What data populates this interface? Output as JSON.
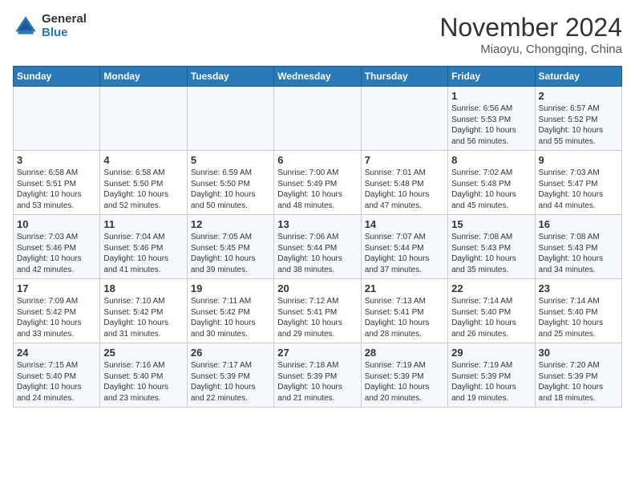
{
  "logo": {
    "general": "General",
    "blue": "Blue"
  },
  "title": "November 2024",
  "subtitle": "Miaoyu, Chongqing, China",
  "headers": [
    "Sunday",
    "Monday",
    "Tuesday",
    "Wednesday",
    "Thursday",
    "Friday",
    "Saturday"
  ],
  "weeks": [
    [
      {
        "day": "",
        "content": ""
      },
      {
        "day": "",
        "content": ""
      },
      {
        "day": "",
        "content": ""
      },
      {
        "day": "",
        "content": ""
      },
      {
        "day": "",
        "content": ""
      },
      {
        "day": "1",
        "content": "Sunrise: 6:56 AM\nSunset: 5:53 PM\nDaylight: 10 hours and 56 minutes."
      },
      {
        "day": "2",
        "content": "Sunrise: 6:57 AM\nSunset: 5:52 PM\nDaylight: 10 hours and 55 minutes."
      }
    ],
    [
      {
        "day": "3",
        "content": "Sunrise: 6:58 AM\nSunset: 5:51 PM\nDaylight: 10 hours and 53 minutes."
      },
      {
        "day": "4",
        "content": "Sunrise: 6:58 AM\nSunset: 5:50 PM\nDaylight: 10 hours and 52 minutes."
      },
      {
        "day": "5",
        "content": "Sunrise: 6:59 AM\nSunset: 5:50 PM\nDaylight: 10 hours and 50 minutes."
      },
      {
        "day": "6",
        "content": "Sunrise: 7:00 AM\nSunset: 5:49 PM\nDaylight: 10 hours and 48 minutes."
      },
      {
        "day": "7",
        "content": "Sunrise: 7:01 AM\nSunset: 5:48 PM\nDaylight: 10 hours and 47 minutes."
      },
      {
        "day": "8",
        "content": "Sunrise: 7:02 AM\nSunset: 5:48 PM\nDaylight: 10 hours and 45 minutes."
      },
      {
        "day": "9",
        "content": "Sunrise: 7:03 AM\nSunset: 5:47 PM\nDaylight: 10 hours and 44 minutes."
      }
    ],
    [
      {
        "day": "10",
        "content": "Sunrise: 7:03 AM\nSunset: 5:46 PM\nDaylight: 10 hours and 42 minutes."
      },
      {
        "day": "11",
        "content": "Sunrise: 7:04 AM\nSunset: 5:46 PM\nDaylight: 10 hours and 41 minutes."
      },
      {
        "day": "12",
        "content": "Sunrise: 7:05 AM\nSunset: 5:45 PM\nDaylight: 10 hours and 39 minutes."
      },
      {
        "day": "13",
        "content": "Sunrise: 7:06 AM\nSunset: 5:44 PM\nDaylight: 10 hours and 38 minutes."
      },
      {
        "day": "14",
        "content": "Sunrise: 7:07 AM\nSunset: 5:44 PM\nDaylight: 10 hours and 37 minutes."
      },
      {
        "day": "15",
        "content": "Sunrise: 7:08 AM\nSunset: 5:43 PM\nDaylight: 10 hours and 35 minutes."
      },
      {
        "day": "16",
        "content": "Sunrise: 7:08 AM\nSunset: 5:43 PM\nDaylight: 10 hours and 34 minutes."
      }
    ],
    [
      {
        "day": "17",
        "content": "Sunrise: 7:09 AM\nSunset: 5:42 PM\nDaylight: 10 hours and 33 minutes."
      },
      {
        "day": "18",
        "content": "Sunrise: 7:10 AM\nSunset: 5:42 PM\nDaylight: 10 hours and 31 minutes."
      },
      {
        "day": "19",
        "content": "Sunrise: 7:11 AM\nSunset: 5:42 PM\nDaylight: 10 hours and 30 minutes."
      },
      {
        "day": "20",
        "content": "Sunrise: 7:12 AM\nSunset: 5:41 PM\nDaylight: 10 hours and 29 minutes."
      },
      {
        "day": "21",
        "content": "Sunrise: 7:13 AM\nSunset: 5:41 PM\nDaylight: 10 hours and 28 minutes."
      },
      {
        "day": "22",
        "content": "Sunrise: 7:14 AM\nSunset: 5:40 PM\nDaylight: 10 hours and 26 minutes."
      },
      {
        "day": "23",
        "content": "Sunrise: 7:14 AM\nSunset: 5:40 PM\nDaylight: 10 hours and 25 minutes."
      }
    ],
    [
      {
        "day": "24",
        "content": "Sunrise: 7:15 AM\nSunset: 5:40 PM\nDaylight: 10 hours and 24 minutes."
      },
      {
        "day": "25",
        "content": "Sunrise: 7:16 AM\nSunset: 5:40 PM\nDaylight: 10 hours and 23 minutes."
      },
      {
        "day": "26",
        "content": "Sunrise: 7:17 AM\nSunset: 5:39 PM\nDaylight: 10 hours and 22 minutes."
      },
      {
        "day": "27",
        "content": "Sunrise: 7:18 AM\nSunset: 5:39 PM\nDaylight: 10 hours and 21 minutes."
      },
      {
        "day": "28",
        "content": "Sunrise: 7:19 AM\nSunset: 5:39 PM\nDaylight: 10 hours and 20 minutes."
      },
      {
        "day": "29",
        "content": "Sunrise: 7:19 AM\nSunset: 5:39 PM\nDaylight: 10 hours and 19 minutes."
      },
      {
        "day": "30",
        "content": "Sunrise: 7:20 AM\nSunset: 5:39 PM\nDaylight: 10 hours and 18 minutes."
      }
    ]
  ]
}
